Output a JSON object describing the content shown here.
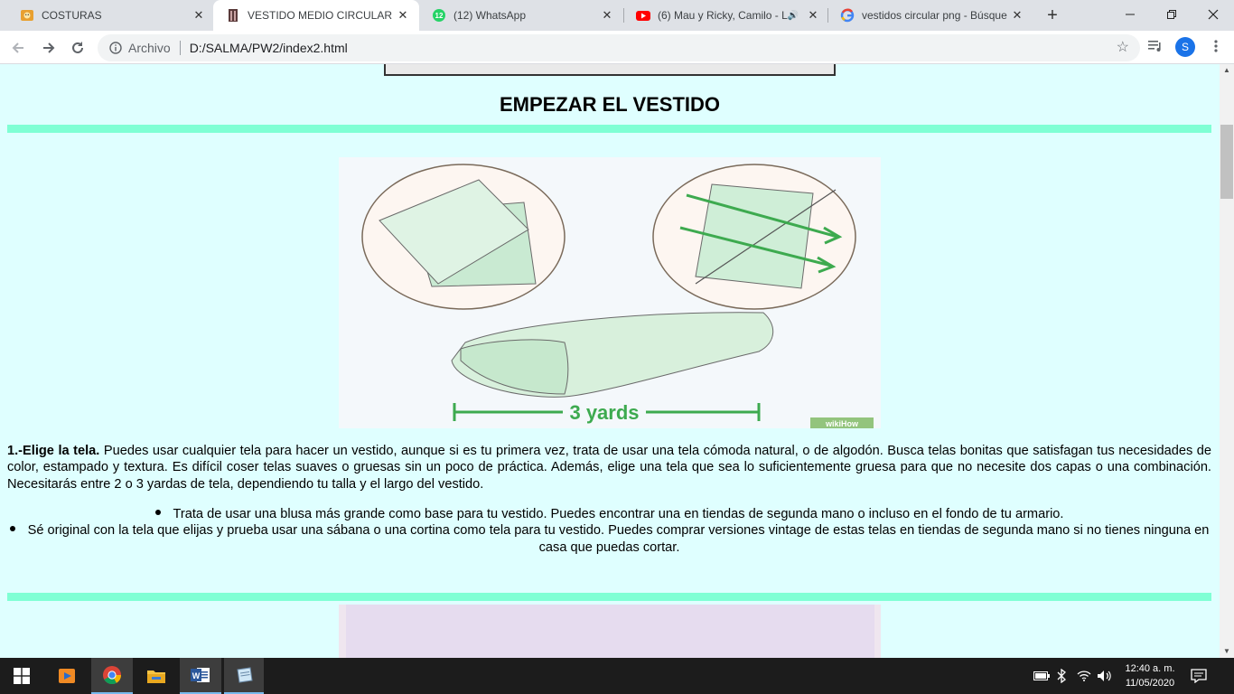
{
  "tabs": [
    {
      "title": "COSTURAS",
      "icon": "costuras-favicon",
      "active": false
    },
    {
      "title": "VESTIDO MEDIO CIRCULAR",
      "icon": "dress-favicon",
      "active": true
    },
    {
      "title": "(12) WhatsApp",
      "icon": "whatsapp-favicon",
      "badge": "12",
      "active": false
    },
    {
      "title": "(6) Mau y Ricky, Camilo - L",
      "icon": "youtube-favicon",
      "active": false
    },
    {
      "title": "vestidos circular png - Búsque",
      "icon": "google-favicon",
      "active": false
    }
  ],
  "address_bar": {
    "scheme_label": "Archivo",
    "url": "D:/SALMA/PW2/index2.html"
  },
  "profile_initial": "S",
  "page": {
    "heading": "EMPEZAR EL VESTIDO",
    "image_label": "3 yards",
    "image_watermark": "wikiHow",
    "step_title": "1.-Elige la tela.",
    "step_body": " Puedes usar cualquier tela para hacer un vestido, aunque si es tu primera vez, trata de usar una tela cómoda natural, o de algodón. Busca telas bonitas que satisfagan tus necesidades de color, estampado y textura. Es difícil coser telas suaves o gruesas sin un poco de práctica. Además, elige una tela que sea lo suficientemente gruesa para que no necesite dos capas o una combinación. Necesitarás entre 2 o 3 yardas de tela, dependiendo tu talla y el largo del vestido.",
    "bullets": [
      "Trata de usar una blusa más grande como base para tu vestido. Puedes encontrar una en tiendas de segunda mano o incluso en el fondo de tu armario.",
      "Sé original con la tela que elijas y prueba usar una sábana o una cortina como tela para tu vestido. Puedes comprar versiones vintage de estas telas en tiendas de segunda mano si no tienes ninguna en casa que puedas cortar."
    ]
  },
  "colors": {
    "page_background": "#dfffff",
    "rule_color": "#7fffd4"
  },
  "taskbar": {
    "apps": [
      "windows-start",
      "media-player",
      "chrome",
      "file-explorer",
      "word",
      "notepad-app"
    ],
    "time": "12:40 a. m.",
    "date": "11/05/2020"
  }
}
